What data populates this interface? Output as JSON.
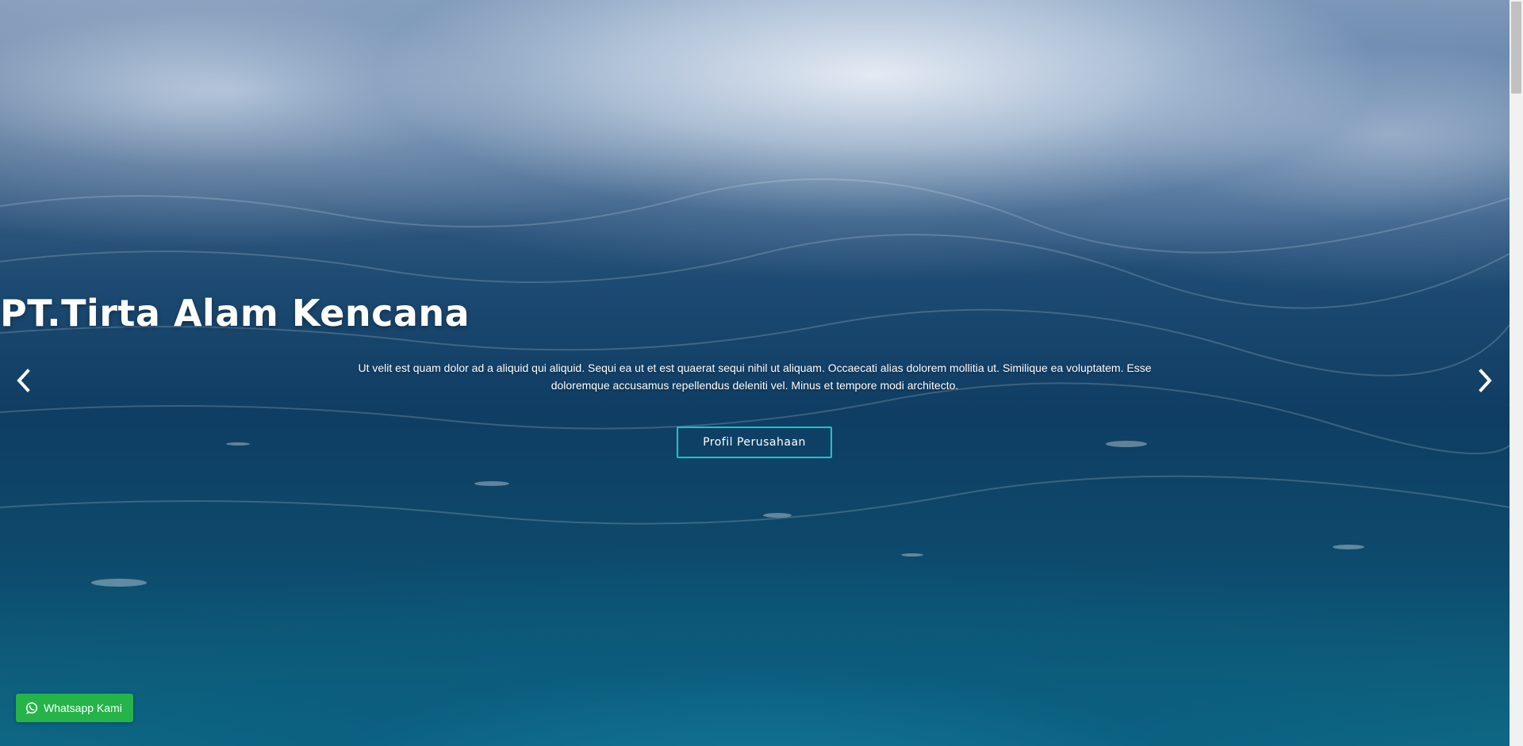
{
  "hero": {
    "title": "PT.Tirta Alam Kencana",
    "description": "Ut velit est quam dolor ad a aliquid qui aliquid. Sequi ea ut et est quaerat sequi nihil ut aliquam. Occaecati alias dolorem mollitia ut. Similique ea voluptatem. Esse doloremque accusamus repellendus deleniti vel. Minus et tempore modi architecto.",
    "cta_label": "Profil Perusahaan",
    "accent_color": "#18c6c8"
  },
  "carousel": {
    "prev_icon": "chevron-left-icon",
    "next_icon": "chevron-right-icon"
  },
  "whatsapp": {
    "label": "Whatsapp Kami",
    "icon": "whatsapp-icon",
    "color": "#25b34a"
  }
}
